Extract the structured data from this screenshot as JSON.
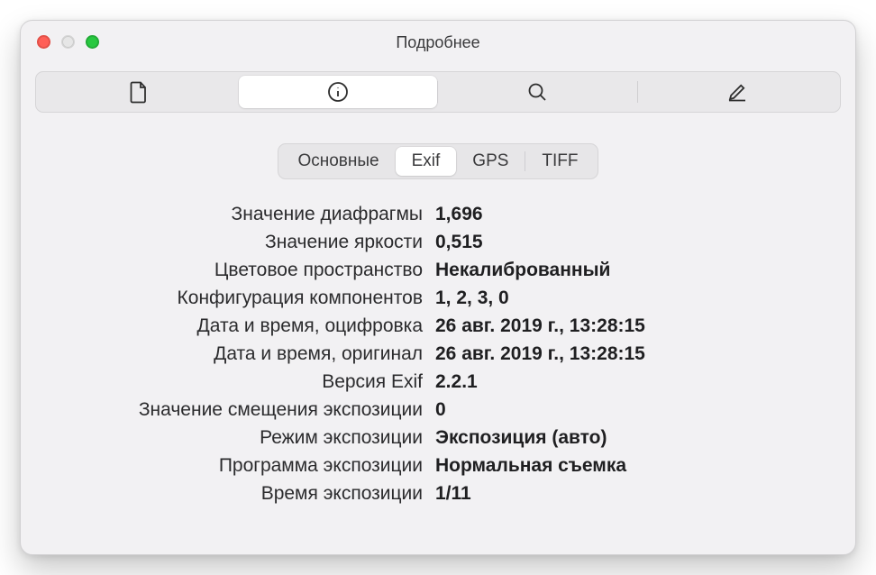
{
  "window": {
    "title": "Подробнее"
  },
  "toolbar": {
    "items": [
      {
        "name": "file-icon",
        "active": false
      },
      {
        "name": "info-icon",
        "active": true
      },
      {
        "name": "search-icon",
        "active": false
      },
      {
        "name": "edit-icon",
        "active": false
      }
    ]
  },
  "tabs": {
    "items": [
      {
        "label": "Основные",
        "active": false
      },
      {
        "label": "Exif",
        "active": true
      },
      {
        "label": "GPS",
        "active": false
      },
      {
        "label": "TIFF",
        "active": false
      }
    ]
  },
  "props": [
    {
      "label": "Значение диафрагмы",
      "value": "1,696"
    },
    {
      "label": "Значение яркости",
      "value": "0,515"
    },
    {
      "label": "Цветовое пространство",
      "value": "Некалиброванный"
    },
    {
      "label": "Конфигурация компонентов",
      "value": "1, 2, 3, 0"
    },
    {
      "label": "Дата и время, оцифровка",
      "value": "26 авг. 2019 г., 13:28:15"
    },
    {
      "label": "Дата и время, оригинал",
      "value": "26 авг. 2019 г., 13:28:15"
    },
    {
      "label": "Версия Exif",
      "value": "2.2.1"
    },
    {
      "label": "Значение смещения экспозиции",
      "value": "0"
    },
    {
      "label": "Режим экспозиции",
      "value": "Экспозиция (авто)"
    },
    {
      "label": "Программа экспозиции",
      "value": "Нормальная съемка"
    },
    {
      "label": "Время экспозиции",
      "value": "1/11"
    }
  ]
}
